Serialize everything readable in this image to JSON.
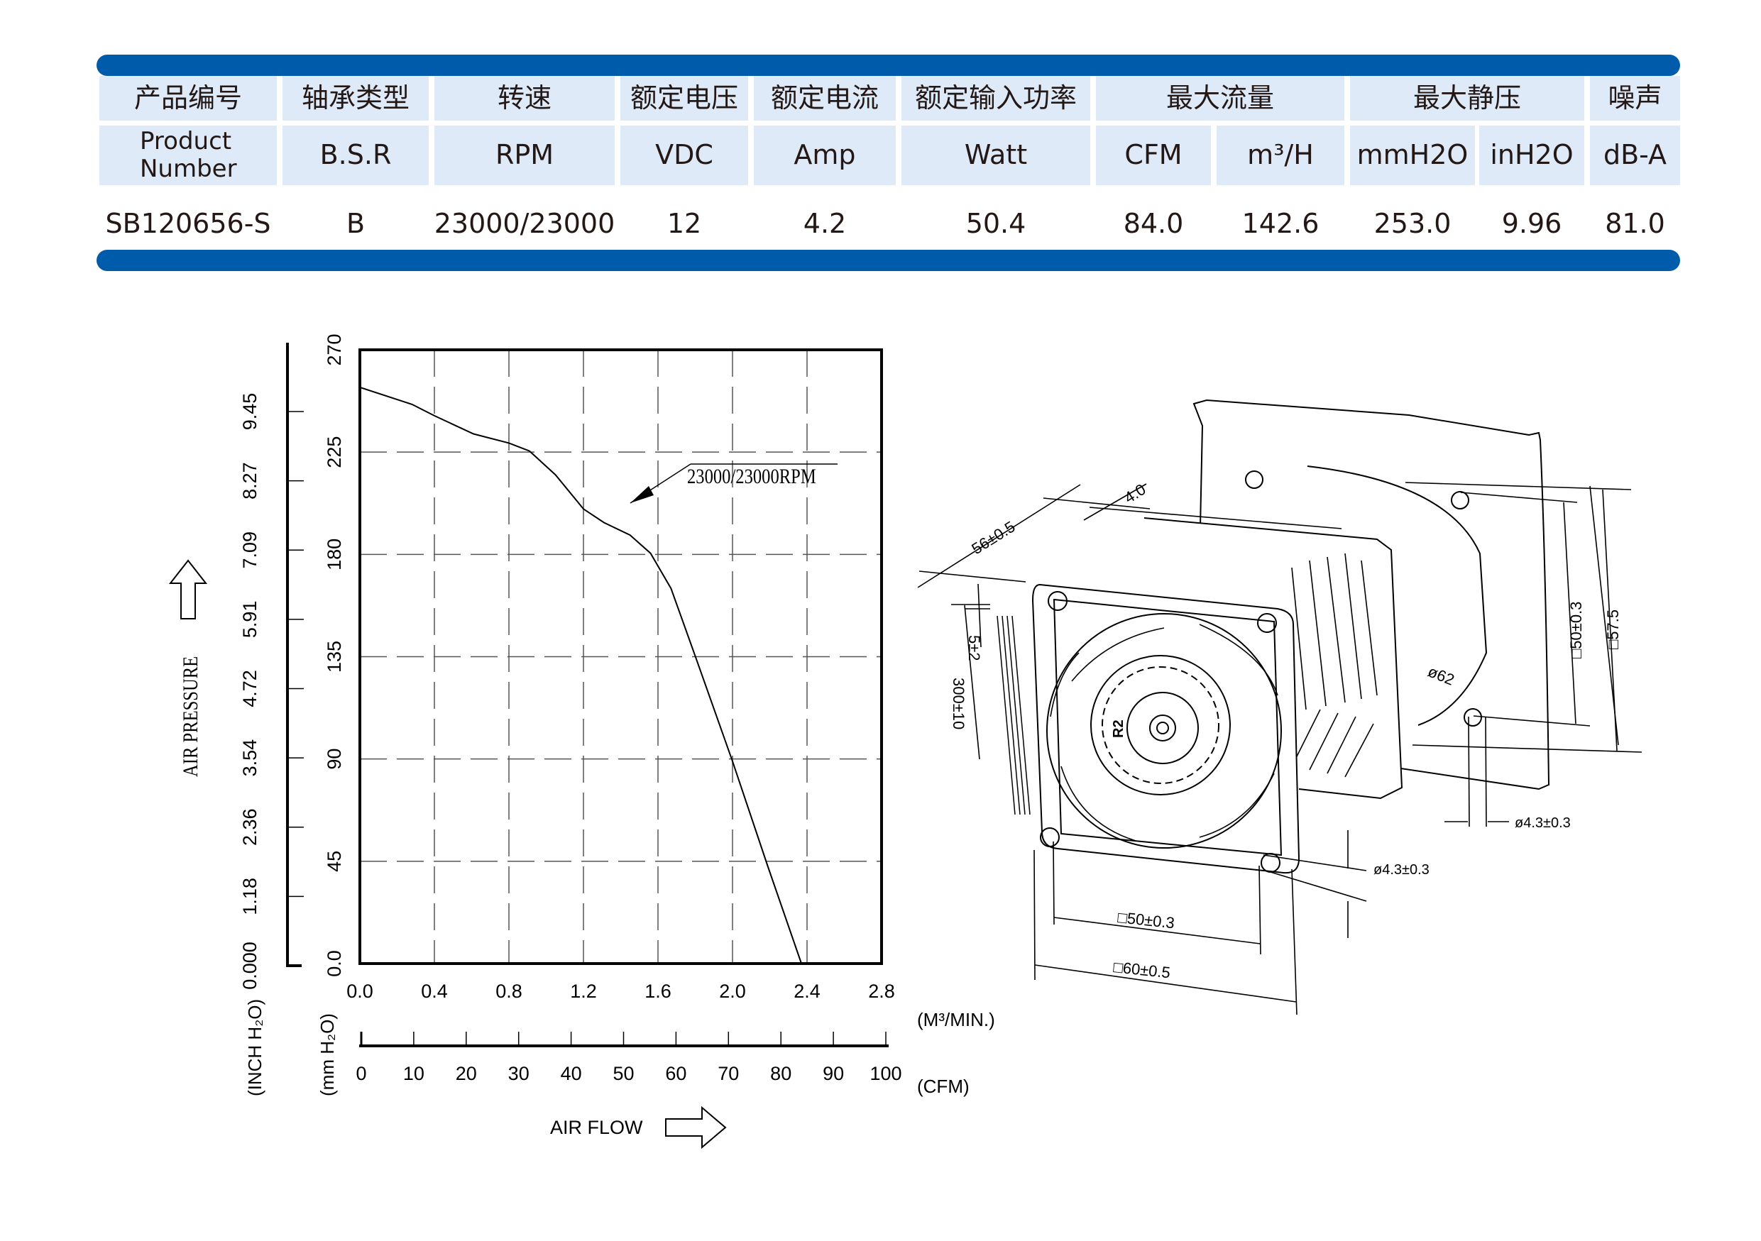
{
  "spec_table": {
    "header_cn": [
      "产品编号",
      "轴承类型",
      "转速",
      "额定电压",
      "额定电流",
      "额定输入功率",
      "最大流量",
      "最大静压",
      "噪声"
    ],
    "header_en": [
      "Product Number",
      "B.S.R",
      "RPM",
      "VDC",
      "Amp",
      "Watt",
      "CFM",
      "m³/H",
      "mmH2O",
      "inH2O",
      "dB-A"
    ],
    "row": [
      "SB120656-S",
      "B",
      "23000/23000",
      "12",
      "4.2",
      "50.4",
      "84.0",
      "142.6",
      "253.0",
      "9.96",
      "81.0"
    ],
    "accent_color": "#005bab",
    "header_bg": "#deeaf8"
  },
  "chart_data": {
    "type": "line",
    "title": "",
    "xlabel": "AIR FLOW",
    "x_unit_primary": "(M³/MIN.)",
    "x_unit_secondary": "(CFM)",
    "ylabel": "AIR PRESSURE",
    "y_unit_primary": "(mm H₂O)",
    "y_unit_secondary": "(INCH H₂O)",
    "xlim": [
      0,
      2.8
    ],
    "ylim": [
      0,
      270
    ],
    "grid": true,
    "x_ticks": [
      "0.0",
      "0.4",
      "0.8",
      "1.2",
      "1.6",
      "2.0",
      "2.4",
      "2.8"
    ],
    "x_ticks_cfm": [
      "0",
      "10",
      "20",
      "30",
      "40",
      "50",
      "60",
      "70",
      "80",
      "90",
      "100"
    ],
    "y_ticks": [
      "0.0",
      "45",
      "90",
      "135",
      "180",
      "225",
      "270"
    ],
    "y_ticks_inch": [
      "0.000",
      "1.18",
      "2.36",
      "3.54",
      "4.72",
      "5.91",
      "7.09",
      "8.27",
      "9.45"
    ],
    "series": [
      {
        "name": "23000/23000RPM",
        "x": [
          0.0,
          0.28,
          0.4,
          0.61,
          0.8,
          0.91,
          1.05,
          1.2,
          1.31,
          1.45,
          1.56,
          1.67,
          1.81,
          2.0,
          2.19,
          2.37
        ],
        "y": [
          253.5,
          246,
          241,
          233,
          229,
          225.5,
          215,
          200,
          194,
          188.5,
          180.5,
          165,
          133,
          89,
          42.6,
          0
        ]
      }
    ],
    "annotations": [
      {
        "text": "23000/23000RPM",
        "points_to": [
          1.45,
          188.5
        ]
      }
    ]
  },
  "drawing": {
    "dimensions": {
      "depth": "56±0.5",
      "flange": "4.0",
      "lead_strip": "5±2",
      "lead_length": "300±10",
      "hub_mark": "R2",
      "front_hole_pitch": "□50±0.3",
      "front_frame": "□60±0.5",
      "front_hole_dia": "ø4.3±0.3",
      "rear_hole_dia": "ø4.3±0.3",
      "rear_hole_pitch": "□50±0.3",
      "rear_plate": "□57.5",
      "rear_opening": "ø62"
    }
  }
}
